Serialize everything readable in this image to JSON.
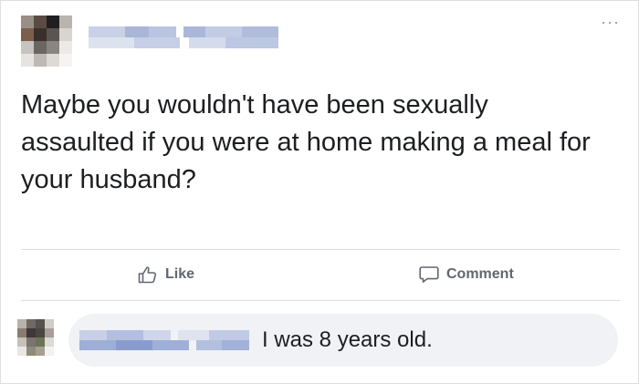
{
  "post": {
    "text": "Maybe you wouldn't have been sexually assaulted if you were at home making a meal for your husband?",
    "more_glyph": "···"
  },
  "actions": {
    "like_label": "Like",
    "comment_label": "Comment"
  },
  "comment": {
    "text": "I was 8 years old."
  },
  "icons": {
    "like": "thumbs-up-icon",
    "comment": "speech-bubble-icon",
    "more": "more-options-icon"
  },
  "colors": {
    "text": "#1c1e21",
    "action_text": "#606770",
    "divider": "#dadde1",
    "comment_bubble": "#f0f2f5"
  }
}
